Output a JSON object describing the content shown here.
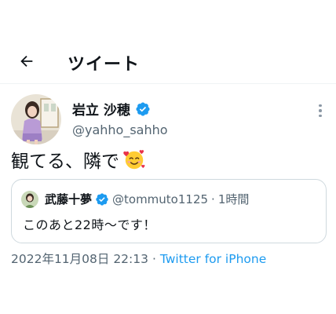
{
  "header": {
    "title": "ツイート",
    "back_icon": "arrow-left-icon"
  },
  "tweet": {
    "author": {
      "display_name": "岩立 沙穂",
      "handle": "@yahho_sahho",
      "verified": true
    },
    "text": "観てる、隣で",
    "emoji": "smiling-face-with-hearts",
    "more_icon": "more-vertical-icon"
  },
  "quoted_tweet": {
    "display_name": "武藤十夢",
    "handle": "@tommuto1125",
    "separator": "·",
    "time": "1時間",
    "verified": true,
    "text": "このあと22時〜です！"
  },
  "footer": {
    "timestamp": "2022年11月08日 22:13",
    "separator": "·",
    "source": "Twitter for iPhone"
  },
  "colors": {
    "accent": "#1d9bf0",
    "secondary_text": "#536471",
    "border": "#cfd9de"
  }
}
